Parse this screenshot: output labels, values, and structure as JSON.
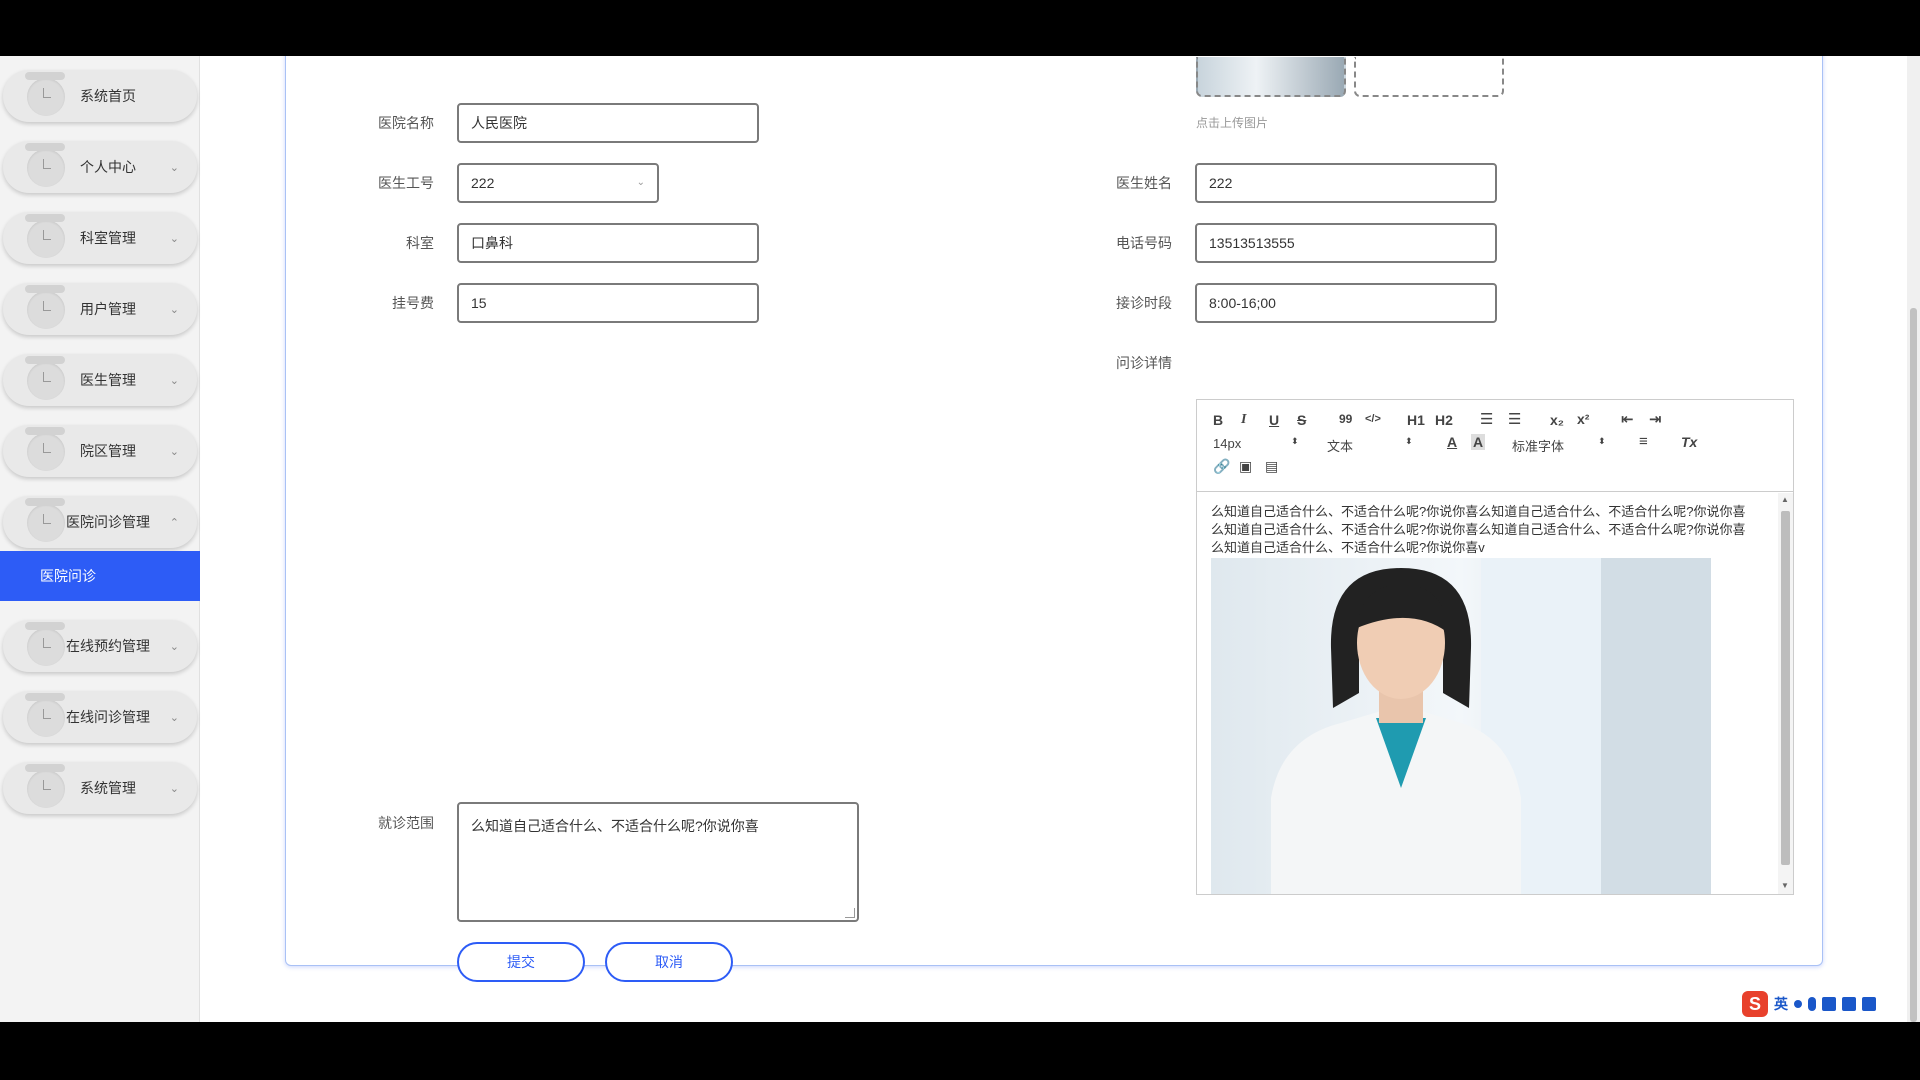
{
  "sidebar": {
    "items": [
      {
        "label": "系统首页",
        "chevron": ""
      },
      {
        "label": "个人中心",
        "chevron": "⌄"
      },
      {
        "label": "科室管理",
        "chevron": "⌄"
      },
      {
        "label": "用户管理",
        "chevron": "⌄"
      },
      {
        "label": "医生管理",
        "chevron": "⌄"
      },
      {
        "label": "院区管理",
        "chevron": "⌄"
      },
      {
        "label": "医院问诊管理",
        "chevron": "⌃"
      },
      {
        "label": "在线预约管理",
        "chevron": "⌄"
      },
      {
        "label": "在线问诊管理",
        "chevron": "⌄"
      },
      {
        "label": "系统管理",
        "chevron": "⌄"
      }
    ],
    "active_sub": "医院问诊"
  },
  "form": {
    "upload_hint": "点击上传图片",
    "hospital_name": {
      "label": "医院名称",
      "value": "人民医院"
    },
    "doctor_id": {
      "label": "医生工号",
      "value": "222"
    },
    "doctor_name": {
      "label": "医生姓名",
      "value": "222"
    },
    "department": {
      "label": "科室",
      "value": "口鼻科"
    },
    "phone": {
      "label": "电话号码",
      "value": "13513513555"
    },
    "fee": {
      "label": "挂号费",
      "value": "15"
    },
    "hours": {
      "label": "接诊时段",
      "value": "8:00-16;00"
    },
    "details_label": "问诊详情",
    "scope": {
      "label": "就诊范围",
      "value": "么知道自己适合什么、不适合什么呢?你说你喜"
    },
    "submit": "提交",
    "cancel": "取消"
  },
  "editor": {
    "bold": "B",
    "italic": "I",
    "underline": "U",
    "strike": "S",
    "quote": "99",
    "code": "</>",
    "h1": "H1",
    "h2": "H2",
    "sub": "x₂",
    "sup": "x²",
    "clear": "Tx",
    "size_select": "14px",
    "type_select": "文本",
    "font_select": "标准字体",
    "content": "么知道自己适合什么、不适合什么呢?你说你喜么知道自己适合什么、不适合什么呢?你说你喜么知道自己适合什么、不适合什么呢?你说你喜么知道自己适合什么、不适合什么呢?你说你喜么知道自己适合什么、不适合什么呢?你说你喜v"
  },
  "ime": {
    "label": "英"
  }
}
